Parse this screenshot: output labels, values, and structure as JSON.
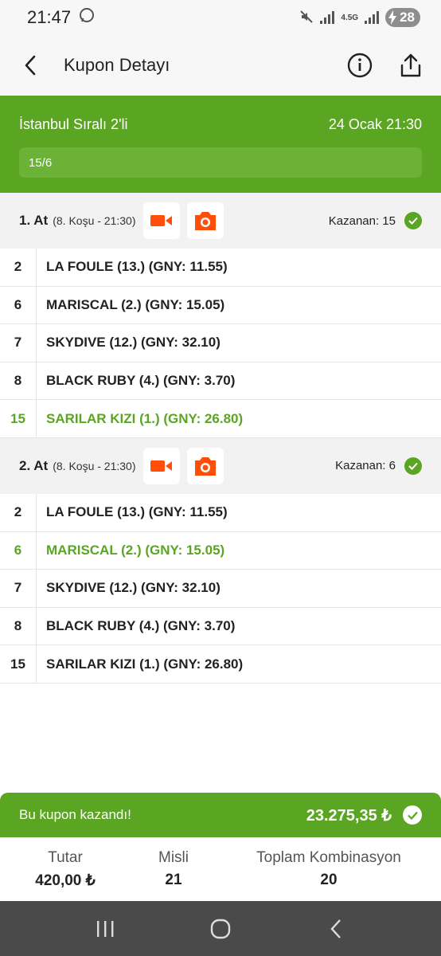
{
  "status": {
    "time": "21:47",
    "network": "4.5G",
    "battery": "28"
  },
  "header": {
    "title": "Kupon Detayı"
  },
  "banner": {
    "bet_type": "İstanbul Sıralı 2'li",
    "date": "24 Ocak 21:30",
    "combination": "15/6"
  },
  "races": [
    {
      "title": "1. At",
      "info": "(8. Koşu - 21:30)",
      "winner": "Kazanan: 15",
      "rows": [
        {
          "num": "2",
          "horse": "LA FOULE (13.) (GNY: 11.55)",
          "win": false
        },
        {
          "num": "6",
          "horse": "MARISCAL (2.) (GNY: 15.05)",
          "win": false
        },
        {
          "num": "7",
          "horse": "SKYDIVE (12.) (GNY: 32.10)",
          "win": false
        },
        {
          "num": "8",
          "horse": "BLACK RUBY (4.) (GNY: 3.70)",
          "win": false
        },
        {
          "num": "15",
          "horse": "SARILAR KIZI (1.) (GNY: 26.80)",
          "win": true
        }
      ]
    },
    {
      "title": "2. At",
      "info": "(8. Koşu - 21:30)",
      "winner": "Kazanan: 6",
      "rows": [
        {
          "num": "2",
          "horse": "LA FOULE (13.) (GNY: 11.55)",
          "win": false
        },
        {
          "num": "6",
          "horse": "MARISCAL (2.) (GNY: 15.05)",
          "win": true
        },
        {
          "num": "7",
          "horse": "SKYDIVE (12.) (GNY: 32.10)",
          "win": false
        },
        {
          "num": "8",
          "horse": "BLACK RUBY (4.) (GNY: 3.70)",
          "win": false
        },
        {
          "num": "15",
          "horse": "SARILAR KIZI (1.) (GNY: 26.80)",
          "win": false
        }
      ]
    }
  ],
  "result": {
    "text": "Bu kupon kazandı!",
    "amount": "23.275,35 ₺"
  },
  "totals": [
    {
      "label": "Tutar",
      "value": "420,00 ₺"
    },
    {
      "label": "Misli",
      "value": "21"
    },
    {
      "label": "Toplam Kombinasyon",
      "value": "20"
    }
  ],
  "colors": {
    "brand_green": "#5aa521",
    "media_orange": "#ff4d0a"
  },
  "icons": [
    "back-arrow-icon",
    "info-icon",
    "share-icon",
    "video-camera-icon",
    "camera-icon",
    "check-icon",
    "recent-apps-icon",
    "home-icon",
    "nav-back-icon"
  ]
}
